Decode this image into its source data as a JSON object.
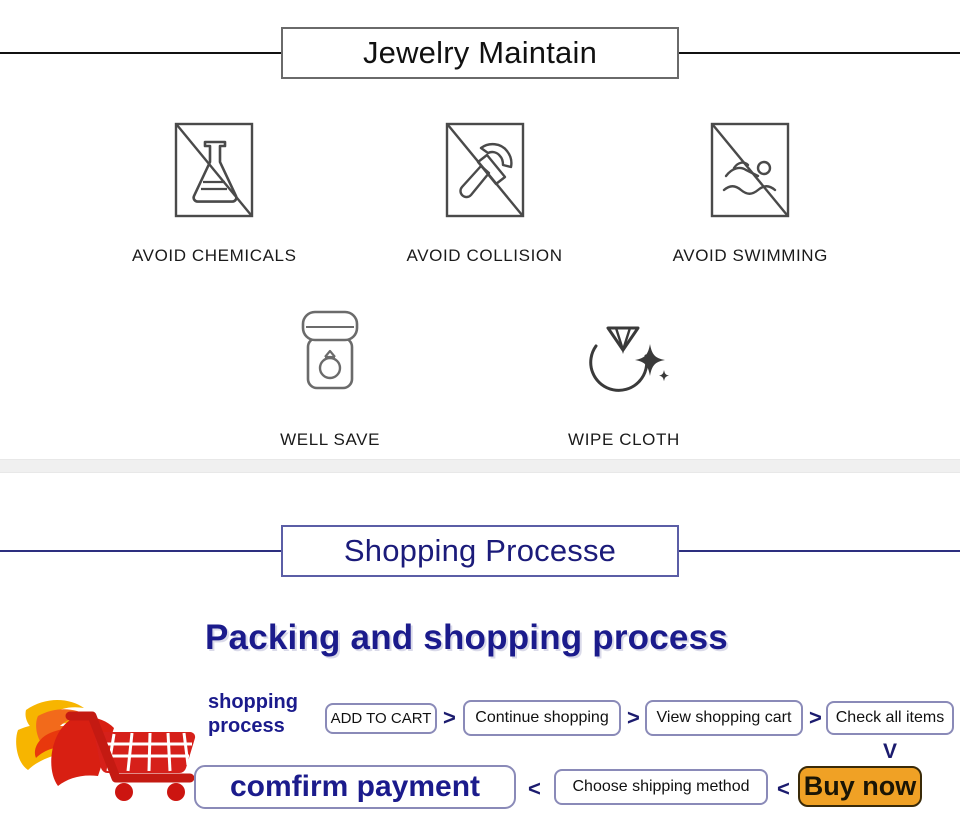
{
  "sections": {
    "maintain": {
      "heading": "Jewelry Maintain",
      "rule_color": "#111111",
      "row1": [
        {
          "icon": "no-chemicals-icon",
          "label": "AVOID CHEMICALS"
        },
        {
          "icon": "no-hammer-icon",
          "label": "AVOID COLLISION"
        },
        {
          "icon": "no-swimming-icon",
          "label": "AVOID SWIMMING"
        }
      ],
      "row2": [
        {
          "icon": "jewelry-box-icon",
          "label": "WELL SAVE"
        },
        {
          "icon": "ring-sparkle-icon",
          "label": "WIPE CLOTH"
        }
      ]
    },
    "shopping": {
      "heading": "Shopping Processe",
      "rule_color": "#2d2f7f",
      "banner": "Packing and shopping process",
      "banner_color": "#1b1b8c",
      "cart_icon": "flaming-shopping-cart-icon",
      "flow_label_line1": "shopping",
      "flow_label_line2": "process",
      "steps_row1": [
        {
          "label": "ADD TO CART"
        },
        {
          "label": "Continue shopping"
        },
        {
          "label": "View shopping cart"
        },
        {
          "label": "Check all items"
        }
      ],
      "steps_row2": [
        {
          "label": "comfirm payment"
        },
        {
          "label": "Choose shipping method"
        },
        {
          "label": "Buy now"
        }
      ],
      "connector_right": ">",
      "connector_left": "<",
      "connector_down": "V",
      "buy_now_color": "#f0a125"
    }
  }
}
